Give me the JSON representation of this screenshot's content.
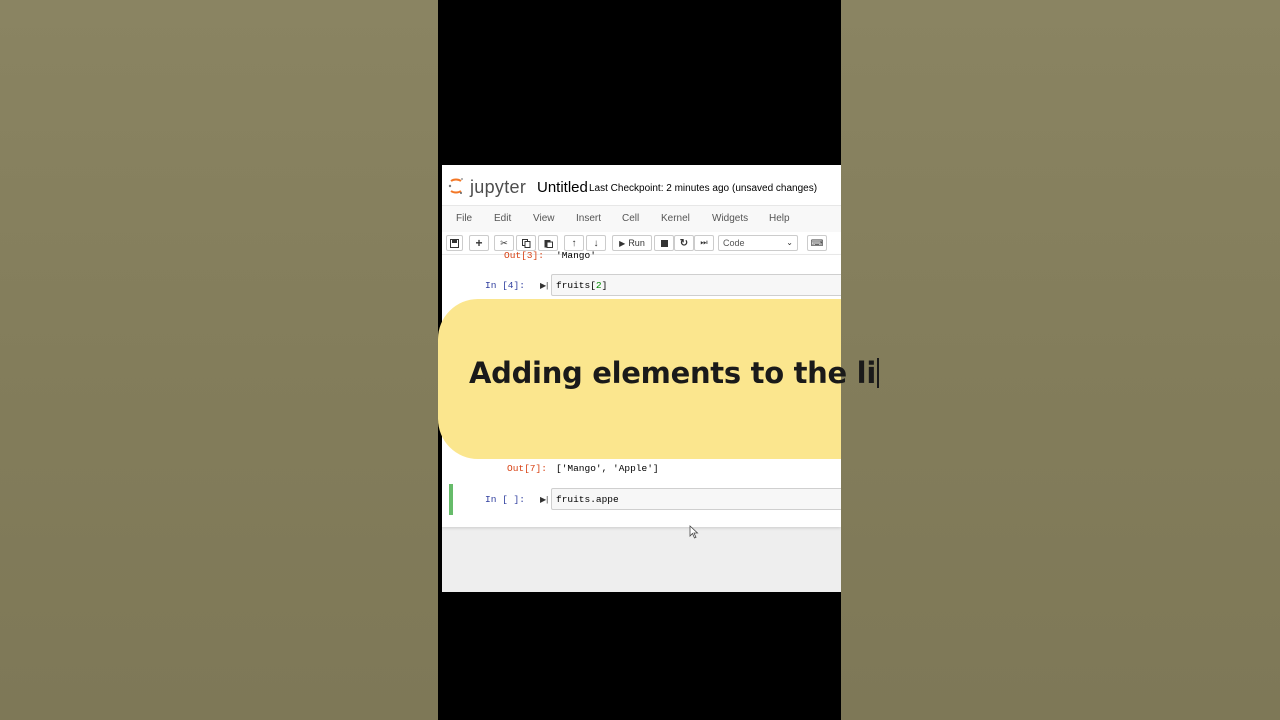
{
  "header": {
    "logo_text": "jupyter",
    "title": "Untitled",
    "checkpoint": "Last Checkpoint: 2 minutes ago",
    "unsaved": "(unsaved changes)"
  },
  "menu": [
    "File",
    "Edit",
    "View",
    "Insert",
    "Cell",
    "Kernel",
    "Widgets",
    "Help"
  ],
  "toolbar": {
    "run_label": "Run",
    "cell_type": "Code"
  },
  "cells": [
    {
      "prompt": "Out[3]:",
      "output": "'Mango'"
    },
    {
      "prompt": "In [4]:",
      "code_prefix": "fruits[",
      "code_num": "2",
      "code_suffix": "]"
    },
    {
      "prompt": "Out[7]:",
      "output": "['Mango', 'Apple']"
    },
    {
      "prompt": "In [ ]:",
      "code": "fruits.appe"
    }
  ],
  "caption": "Adding elements to the li",
  "colors": {
    "background": "#857f5c",
    "caption_bg": "#fbe68e",
    "selected_cell": "#66bb6a",
    "in_prompt": "#303f9f",
    "out_prompt": "#d84315"
  }
}
